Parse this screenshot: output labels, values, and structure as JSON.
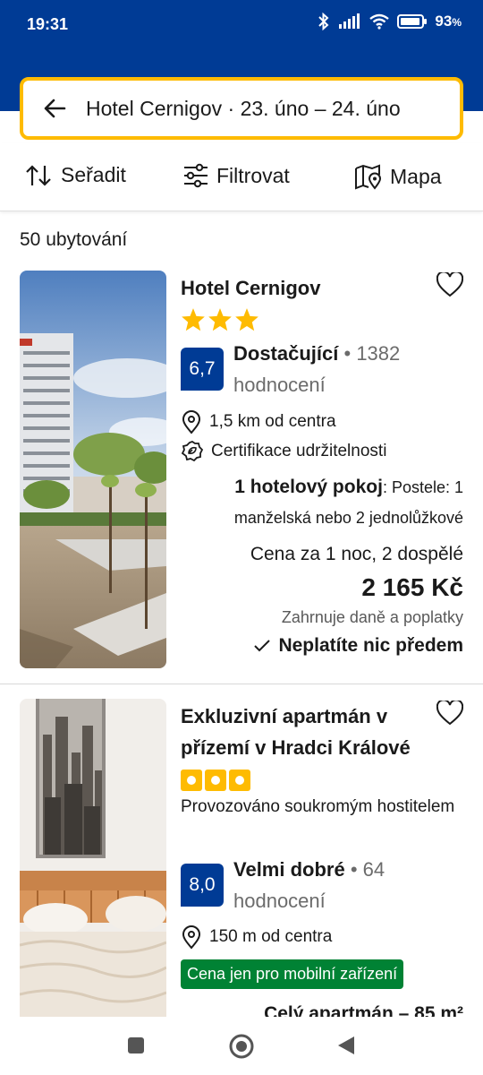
{
  "status_bar": {
    "time": "19:31",
    "battery": "93",
    "icons": [
      "bluetooth-icon",
      "signal-icon",
      "wifi-icon",
      "battery-icon"
    ]
  },
  "search": {
    "text": "Hotel Cernigov · 23. úno – 24. úno"
  },
  "toolbar": {
    "sort_label": "Seřadit",
    "filter_label": "Filtrovat",
    "map_label": "Mapa"
  },
  "results_count": "50 ubytování",
  "listings": [
    {
      "name": "Hotel Cernigov",
      "stars": 3,
      "score": "6,7",
      "rating_word": "Dostačující",
      "rating_count": "• 1382 hodnocení",
      "distance": "1,5 km od centra",
      "sustainability": "Certifikace udržitelnosti",
      "room_title": "1 hotelový pokoj",
      "room_beds": ": Postele: 1 manželská nebo 2 jednolůžkové",
      "price_label": "Cena za 1 noc, 2 dospělé",
      "price": "2 165 Kč",
      "taxes": "Zahrnuje daně a poplatky",
      "no_prepayment": "Neplatíte nic předem"
    },
    {
      "name": "Exkluzivní apartmán v přízemí v Hradci Králové",
      "rating_squares": 3,
      "host": "Provozováno soukromým hostitelem",
      "score": "8,0",
      "rating_word": "Velmi dobré",
      "rating_count": "• 64 hodnocení",
      "distance": "150 m od centra",
      "mobile_badge": "Cena jen pro mobilní zařízení",
      "unit_partial": "Celý apartmán – 85 m²"
    }
  ],
  "colors": {
    "brand_blue": "#003b95",
    "search_border": "#febb02",
    "star_yellow": "#febb02",
    "badge_green": "#008234"
  }
}
